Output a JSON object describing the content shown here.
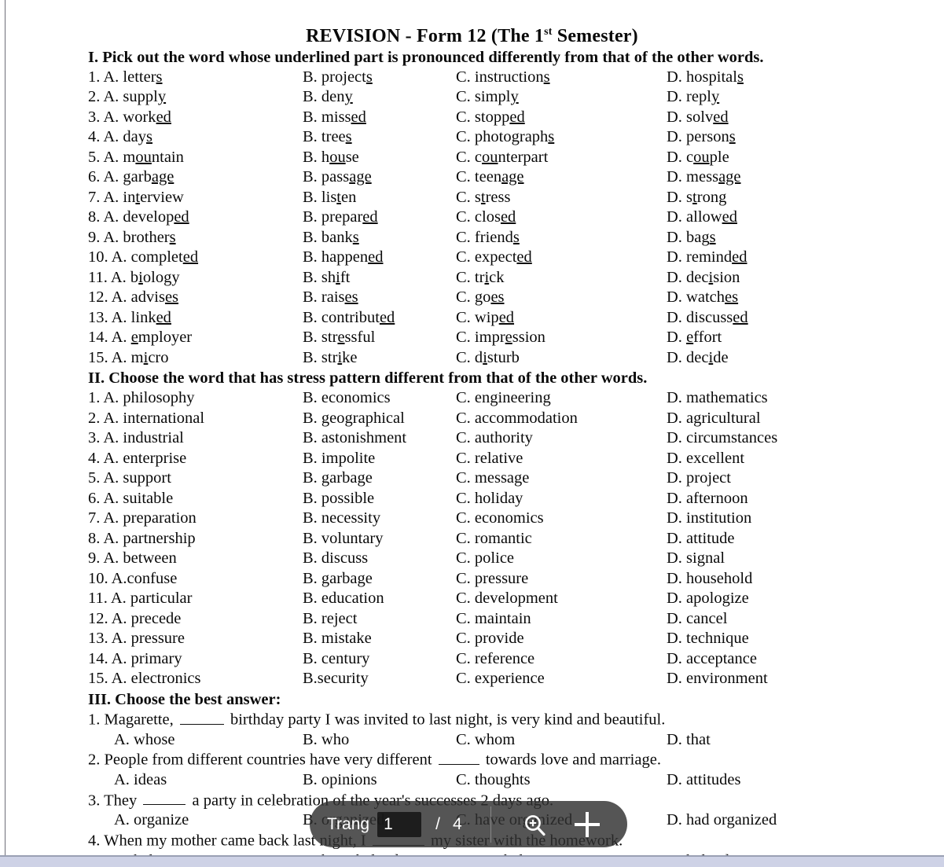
{
  "document": {
    "title_main": "REVISION - Form 12 (The 1",
    "title_sup": "st",
    "title_tail": " Semester)",
    "title_full": "REVISION - Form 12 (The 1st Semester)"
  },
  "sections": {
    "one": {
      "heading": "I. Pick out the word whose underlined part is pronounced differently from that of the other words.",
      "rows": [
        {
          "num": "1.",
          "a": "A. letters",
          "a_u": "s",
          "b": "B. projects",
          "b_u": "s",
          "c": "C. instructions",
          "c_u": "s",
          "d": "D. hospitals",
          "d_u": "s"
        },
        {
          "num": "2.",
          "a": "A. supply",
          "a_u": "y",
          "b": "B. deny",
          "b_u": "y",
          "c": "C. simply",
          "c_u": "y",
          "d": "D. reply",
          "d_u": "y"
        },
        {
          "num": "3.",
          "a": "A. worked",
          "a_u": "ed",
          "b": "B. missed",
          "b_u": "ed",
          "c": "C. stopped",
          "c_u": "ed",
          "d": "D. solved",
          "d_u": "ed"
        },
        {
          "num": "4.",
          "a": "A. days",
          "a_u": "s",
          "b": "B. trees",
          "b_u": "s",
          "c": "C. photographs",
          "c_u": "s",
          "d": "D. persons",
          "d_u": "s"
        },
        {
          "num": "5.",
          "a": "A. mountain",
          "a_u": "ou",
          "b": "B. house",
          "b_u": "ou",
          "c": "C. counterpart",
          "c_u": "ou",
          "d": "D. couple",
          "d_u": "ou"
        },
        {
          "num": "6.",
          "a": "A. garbage",
          "a_u": "age",
          "b": "B. passage",
          "b_u": "age",
          "c": "C. teenage",
          "c_u": "age",
          "d": "D. message",
          "d_u": "age"
        },
        {
          "num": "7.",
          "a": "A. interview",
          "a_u": "t",
          "b": "B. listen",
          "b_u": "t",
          "c": "C. stress",
          "c_u": "t",
          "d": "D. strong",
          "d_u": "t"
        },
        {
          "num": "8.",
          "a": "A. developed",
          "a_u": "ed",
          "b": "B. prepared",
          "b_u": "ed",
          "c": "C. closed",
          "c_u": "ed",
          "d": "D. allowed",
          "d_u": "ed"
        },
        {
          "num": "9.",
          "a": "A. brothers",
          "a_u": "s",
          "b": "B. banks",
          "b_u": "s",
          "c": "C. friends",
          "c_u": "s",
          "d": "D. bags",
          "d_u": "s"
        },
        {
          "num": "10.",
          "a": "A. completed",
          "a_u": "ed",
          "b": "B. happened",
          "b_u": "ed",
          "c": "C. expected",
          "c_u": "ed",
          "d": "D. reminded",
          "d_u": "ed"
        },
        {
          "num": "11.",
          "a": "A. biology",
          "a_u": "i",
          "b": "B. shift",
          "b_u": "i",
          "c": "C. trick",
          "c_u": "i",
          "d": "D. decision",
          "d_u": "i"
        },
        {
          "num": "12.",
          "a": "A. advises",
          "a_u": "es",
          "b": "B. raises",
          "b_u": "es",
          "c": "C. goes",
          "c_u": "es",
          "d": "D. watches",
          "d_u": "es"
        },
        {
          "num": "13.",
          "a": "A. linked",
          "a_u": "ed",
          "b": "B. contributed",
          "b_u": "ed",
          "c": "C. wiped",
          "c_u": "ed",
          "d": "D. discussed",
          "d_u": "ed"
        },
        {
          "num": "14.",
          "a": "A. employer",
          "a_u": "e",
          "b": "B. stressful",
          "b_u": "e",
          "c": "C. impression",
          "c_u": "e",
          "d": "D. effort",
          "d_u": "e"
        },
        {
          "num": "15.",
          "a": "A. micro",
          "a_u": "i",
          "b": "B. strike",
          "b_u": "i",
          "c": "C. disturb",
          "c_u": "i",
          "d": "D. decide",
          "d_u": "i"
        }
      ]
    },
    "two": {
      "heading": "II. Choose the word that has stress pattern different from that of the other words.",
      "rows": [
        {
          "num": "1.",
          "a": "1. A. philosophy",
          "b": "B. economics",
          "c": "C. engineering",
          "d": "D. mathematics"
        },
        {
          "num": "2.",
          "a": "2. A. international",
          "b": "B. geographical",
          "c": "C. accommodation",
          "d": "D. agricultural"
        },
        {
          "num": "3.",
          "a": "3. A. industrial",
          "b": "B. astonishment",
          "c": "C. authority",
          "d": "D. circumstances"
        },
        {
          "num": "4.",
          "a": "4. A. enterprise",
          "b": "B. impolite",
          "c": "C. relative",
          "d": "D. excellent"
        },
        {
          "num": "5.",
          "a": "5. A. support",
          "b": "B. garbage",
          "c": "C. message",
          "d": "D. project"
        },
        {
          "num": "6.",
          "a": "6. A. suitable",
          "b": "B. possible",
          "c": "C. holiday",
          "d": "D. afternoon"
        },
        {
          "num": "7.",
          "a": "7. A. preparation",
          "b": "B. necessity",
          "c": "C. economics",
          "d": "D. institution"
        },
        {
          "num": "8.",
          "a": "8. A. partnership",
          "b": "B. voluntary",
          "c": "C. romantic",
          "d": "D. attitude"
        },
        {
          "num": "9.",
          "a": "9. A. between",
          "b": "B. discuss",
          "c": "C. police",
          "d": "D. signal"
        },
        {
          "num": "10.",
          "a": "10. A.confuse",
          "b": "B. garbage",
          "c": "C. pressure",
          "d": "D. household"
        },
        {
          "num": "11.",
          "a": "11. A. particular",
          "b": "B. education",
          "c": "C. development",
          "d": "D. apologize"
        },
        {
          "num": "12.",
          "a": "12. A. precede",
          "b": "B. reject",
          "c": "C. maintain",
          "d": "D. cancel"
        },
        {
          "num": "13.",
          "a": "13. A. pressure",
          "b": "B. mistake",
          "c": "C. provide",
          "d": "D. technique"
        },
        {
          "num": "14.",
          "a": "14. A. primary",
          "b": "B. century",
          "c": "C. reference",
          "d": "D. acceptance"
        },
        {
          "num": "15.",
          "a": "15. A. electronics",
          "b": "B.security",
          "c": "C. experience",
          "d": "D. environment"
        }
      ]
    },
    "three": {
      "heading": "III. Choose the best answer:",
      "questions": [
        {
          "stem_pre": "1.  Magarette,",
          "stem_post": "birthday party I was invited to last night, is very kind and beautiful.",
          "a": "A. whose",
          "b": "B. who",
          "c": "C. whom",
          "d": "D. that"
        },
        {
          "stem_pre": "2. People from different countries have very different",
          "stem_post": "towards love and marriage.",
          "a": "A. ideas",
          "b": "B. opinions",
          "c": "C. thoughts",
          "d": "D. attitudes"
        },
        {
          "stem_pre": "3. They",
          "stem_post": "a party in celebration of the year's successes 2 days ago.",
          "a": "A. organize",
          "b": "B. organized",
          "c": "C. have organized",
          "d": "D. had organized"
        },
        {
          "stem_pre": "4. When my mother came back last night, I",
          "stem_post": "my sister with the homework.",
          "a": "A. help",
          "b": "B. have helped",
          "c": "C. was helping",
          "d": "D. helped"
        }
      ]
    }
  },
  "viewer_toolbar": {
    "page_label": "Trang",
    "current_page": "1",
    "separator": "/",
    "total_pages": "4",
    "zoom_in_icon": "magnifier-plus-icon",
    "add_icon": "plus-icon",
    "background_color": "#303030"
  }
}
